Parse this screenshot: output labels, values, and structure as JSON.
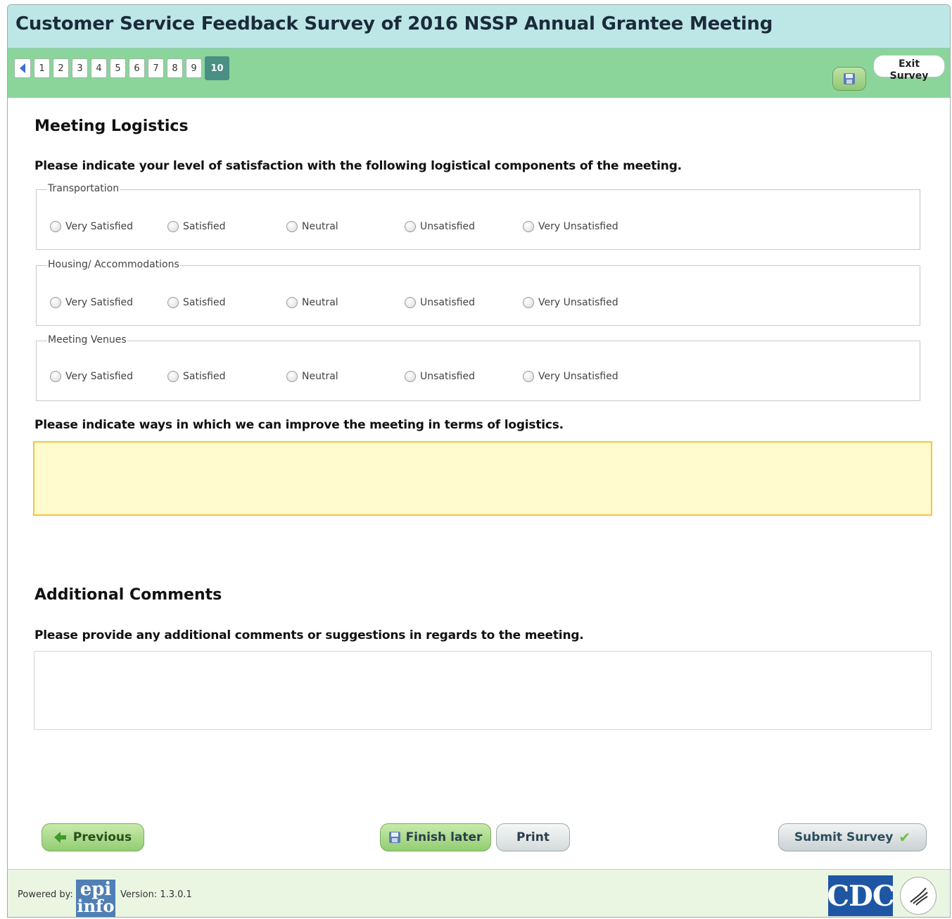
{
  "survey_title": "Customer Service Feedback Survey of 2016 NSSP Annual Grantee Meeting",
  "pager": {
    "pages": [
      "1",
      "2",
      "3",
      "4",
      "5",
      "6",
      "7",
      "8",
      "9"
    ],
    "current_page": "10"
  },
  "exit_button": "Exit\nSurvey",
  "sections": {
    "logistics": {
      "title": "Meeting Logistics",
      "question": "Please indicate your level of satisfaction with the following logistical components of the meeting.",
      "groups": [
        {
          "label": "Transportation"
        },
        {
          "label": "Housing/ Accommodations"
        },
        {
          "label": "Meeting Venues"
        }
      ],
      "options": [
        "Very Satisfied",
        "Satisfied",
        "Neutral",
        "Unsatisfied",
        "Very Unsatisfied"
      ],
      "improve_question": "Please indicate ways in which we can improve the meeting in terms of logistics.",
      "improve_value": ""
    },
    "comments": {
      "title": "Additional Comments",
      "question": "Please provide any additional comments or suggestions in regards to the meeting.",
      "value": ""
    }
  },
  "buttons": {
    "previous": "Previous",
    "finish_later": "Finish later",
    "print": "Print",
    "submit": "Submit Survey"
  },
  "footer": {
    "powered_by": "Powered by:",
    "logo_line1": "epi",
    "logo_line2": "info",
    "version": "Version: 1.3.0.1",
    "cdc_logo": "CDC"
  },
  "colors": {
    "title_bar": "#bde6e6",
    "nav_bar": "#8bd59b",
    "active_page": "#4a8f84",
    "highlight_field": "#fffbce",
    "footer": "#eaf6e2"
  },
  "icons": [
    "prev-page-arrow-icon",
    "save-icon",
    "back-arrow-icon",
    "floppy-disk-icon",
    "checkmark-icon",
    "hhs-eagle-icon"
  ]
}
